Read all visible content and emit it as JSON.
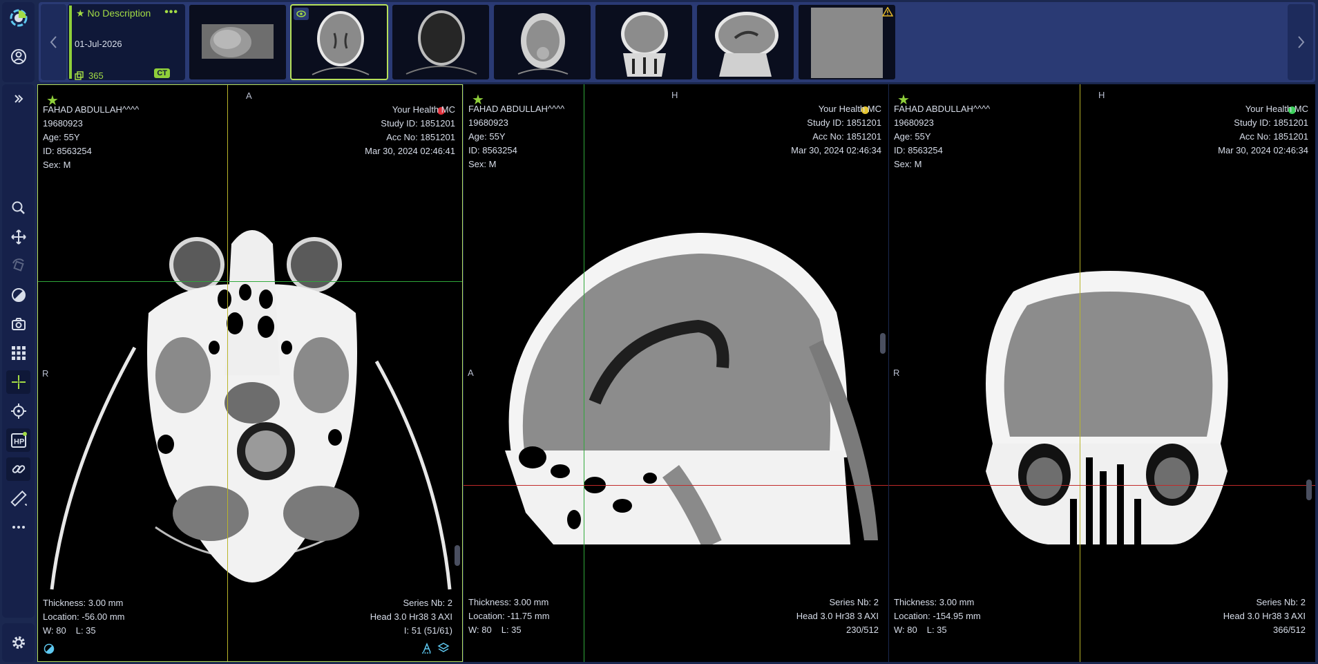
{
  "series": {
    "description": "No Description",
    "date": "01-Jul-2026",
    "count": "365",
    "modality": "CT"
  },
  "viewports": [
    {
      "orient_top": "A",
      "orient_left": "R",
      "patient_name": "FAHAD ABDULLAH^^^^",
      "dob": "19680923",
      "age": "Age: 55Y",
      "pid": "ID: 8563254",
      "sex": "Sex: M",
      "institution": "Your Health MC",
      "study_id": "Study ID: 1851201",
      "acc_no": "Acc No: 1851201",
      "datetime": "Mar 30, 2024 02:46:41",
      "thickness": "Thickness: 3.00 mm",
      "location": "Location: -56.00 mm",
      "window": "W: 80",
      "level": "L: 35",
      "series_nb": "Series Nb: 2",
      "series_desc": "Head 3.0 Hr38 3 AXI",
      "image_index": "I: 51 (51/61)",
      "marker_color": "#e0303a"
    },
    {
      "orient_top": "H",
      "orient_left": "A",
      "patient_name": "FAHAD ABDULLAH^^^^",
      "dob": "19680923",
      "age": "Age: 55Y",
      "pid": "ID: 8563254",
      "sex": "Sex: M",
      "institution": "Your Health MC",
      "study_id": "Study ID: 1851201",
      "acc_no": "Acc No: 1851201",
      "datetime": "Mar 30, 2024 02:46:34",
      "thickness": "Thickness: 3.00 mm",
      "location": "Location: -11.75 mm",
      "window": "W: 80",
      "level": "L: 35",
      "series_nb": "Series Nb: 2",
      "series_desc": "Head 3.0 Hr38 3 AXI",
      "image_index": "230/512",
      "marker_color": "#e6c631"
    },
    {
      "orient_top": "H",
      "orient_left": "R",
      "patient_name": "FAHAD ABDULLAH^^^^",
      "dob": "19680923",
      "age": "Age: 55Y",
      "pid": "ID: 8563254",
      "sex": "Sex: M",
      "institution": "Your Health MC",
      "study_id": "Study ID: 1851201",
      "acc_no": "Acc No: 1851201",
      "datetime": "Mar 30, 2024 02:46:34",
      "thickness": "Thickness: 3.00 mm",
      "location": "Location: -154.95 mm",
      "window": "W: 80",
      "level": "L: 35",
      "series_nb": "Series Nb: 2",
      "series_desc": "Head 3.0 Hr38 3 AXI",
      "image_index": "366/512",
      "marker_color": "#3ccf5a"
    }
  ],
  "colors": {
    "accent": "#a3dc45",
    "panel": "#16214a",
    "background": "#1b2850",
    "crosshair_green": "#2fa83a",
    "crosshair_yellow": "#b9b52a",
    "crosshair_red": "#c02a2a"
  },
  "toolbar_icons": [
    "app-logo-icon",
    "user-icon",
    "expand-icon",
    "zoom-icon",
    "pan-icon",
    "rotate-icon",
    "window-level-icon",
    "snapshot-icon",
    "grid-layout-icon",
    "crosshair-icon",
    "reference-lines-icon",
    "hanging-protocol-icon",
    "link-icon",
    "ruler-icon",
    "more-icon",
    "settings-icon"
  ]
}
